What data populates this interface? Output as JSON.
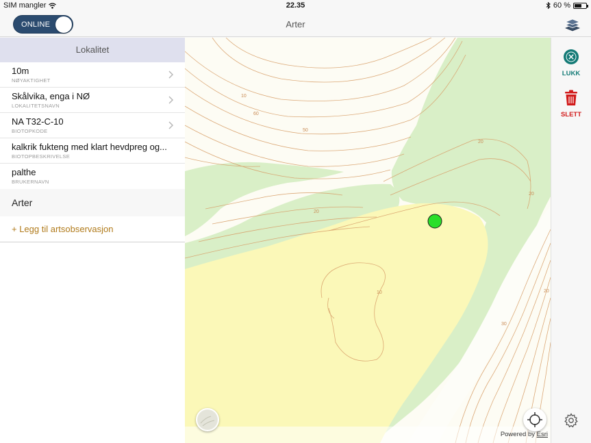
{
  "status": {
    "carrier": "SIM mangler",
    "time": "22.35",
    "battery_text": "60 %",
    "battery_level": 0.6
  },
  "nav": {
    "online_label": "ONLINE",
    "online_on": true,
    "title": "Arter"
  },
  "sidebar": {
    "header": "Lokalitet",
    "rows": [
      {
        "value": "10m",
        "label": "NØYAKTIGHET",
        "has_chevron": true
      },
      {
        "value": "Skålvika, enga i NØ",
        "label": "LOKALITETSNAVN",
        "has_chevron": true
      },
      {
        "value": "NA T32-C-10",
        "label": "BIOTOPKODE",
        "has_chevron": true
      },
      {
        "value": "kalkrik fukteng med klart hevdpreg og...",
        "label": "BIOTOPBESKRIVELSE",
        "has_chevron": false
      },
      {
        "value": "palthe",
        "label": "BRUKERNAVN",
        "has_chevron": false
      }
    ],
    "section_title": "Arter",
    "add_link": "+ Legg til artsobservasjon"
  },
  "map": {
    "contour_labels": [
      "10",
      "60",
      "50",
      "20",
      "20",
      "10",
      "20",
      "30",
      "20"
    ],
    "attribution_prefix": "Powered by",
    "attribution_brand": "Esri",
    "marker_color": "#2adf2a"
  },
  "tools": {
    "close_label": "LUKK",
    "delete_label": "SLETT"
  },
  "colors": {
    "accent_teal": "#137a76",
    "delete_red": "#d11a1a",
    "link_gold": "#b07a1a",
    "toggle_blue": "#2b4b6f"
  }
}
